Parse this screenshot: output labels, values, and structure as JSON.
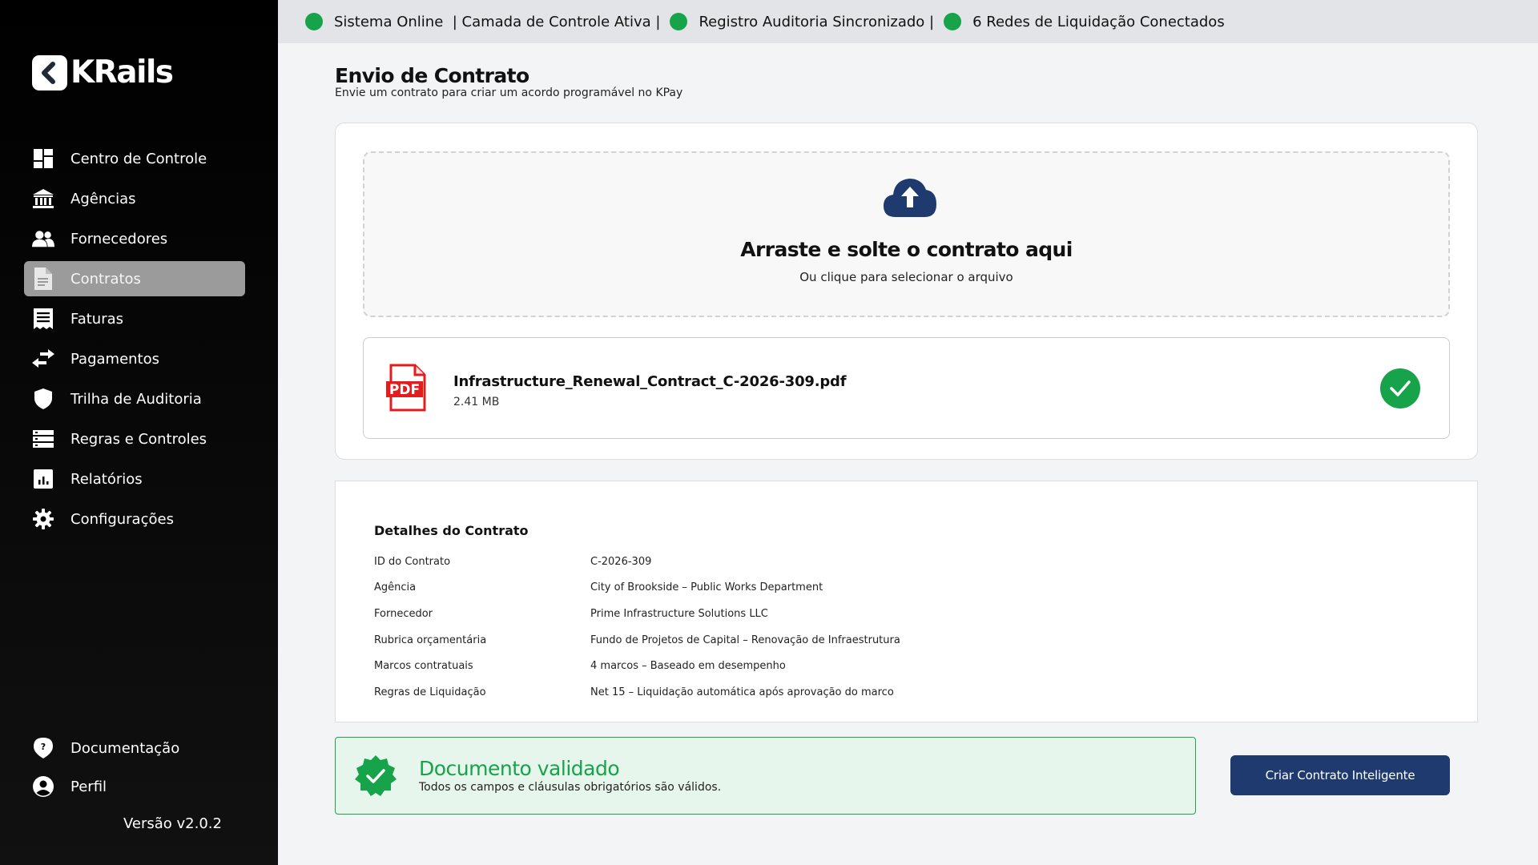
{
  "app": {
    "brand": "KRails"
  },
  "sidebar": {
    "items": [
      {
        "label": "Centro de Controle",
        "icon": "dashboard-icon"
      },
      {
        "label": "Agências",
        "icon": "bank-icon"
      },
      {
        "label": "Fornecedores",
        "icon": "users-icon"
      },
      {
        "label": "Contratos",
        "icon": "document-icon",
        "active": true
      },
      {
        "label": "Faturas",
        "icon": "invoice-icon"
      },
      {
        "label": "Pagamentos",
        "icon": "transfer-icon"
      },
      {
        "label": "Trilha de Auditoria",
        "icon": "shield-icon"
      },
      {
        "label": "Regras e Controles",
        "icon": "server-icon"
      },
      {
        "label": "Relatórios",
        "icon": "report-chart-icon"
      },
      {
        "label": "Configurações",
        "icon": "gear-icon"
      }
    ],
    "bottom": [
      {
        "label": "Documentação",
        "icon": "help-icon"
      },
      {
        "label": "Perfil",
        "icon": "profile-icon"
      }
    ],
    "version": "Versão v2.0.2"
  },
  "status": {
    "segments": [
      "Sistema Online  | Camada de Controle Ativa |",
      "Registro Auditoria Sincronizado |",
      "6 Redes de Liquidação Conectados"
    ],
    "color": "#16a34a"
  },
  "page": {
    "title": "Envio de Contrato",
    "subtitle": "Envie um contrato para criar um acordo programável no KPay"
  },
  "upload": {
    "title": "Arraste e solte o contrato aqui",
    "subtitle": "Ou clique para selecionar o arquivo",
    "file": {
      "name": "Infrastructure_Renewal_Contract_C-2026-309.pdf",
      "size": "2.41 MB",
      "icon_label": "PDF"
    }
  },
  "details": {
    "title": "Detalhes do Contrato",
    "rows": [
      {
        "key": "ID do Contrato",
        "value": "C-2026-309"
      },
      {
        "key": "Agência",
        "value": "City of Brookside – Public Works Department"
      },
      {
        "key": "Fornecedor",
        "value": "Prime Infrastructure Solutions LLC"
      },
      {
        "key": "Rubrica orçamentária",
        "value": "Fundo de Projetos de Capital – Renovação de Infraestrutura"
      },
      {
        "key": "Marcos contratuais",
        "value": "4 marcos – Baseado em desempenho"
      },
      {
        "key": "Regras de Liquidação",
        "value": "Net 15 – Liquidação automática após aprovação do marco"
      }
    ]
  },
  "validation": {
    "title": "Documento validado",
    "subtitle": "Todos os campos e cláusulas obrigatórios são válidos."
  },
  "actions": {
    "create_label": "Criar Contrato Inteligente"
  },
  "colors": {
    "accent": "#1e3a6e",
    "success": "#16a34a",
    "pdf": "#e11d1d"
  }
}
